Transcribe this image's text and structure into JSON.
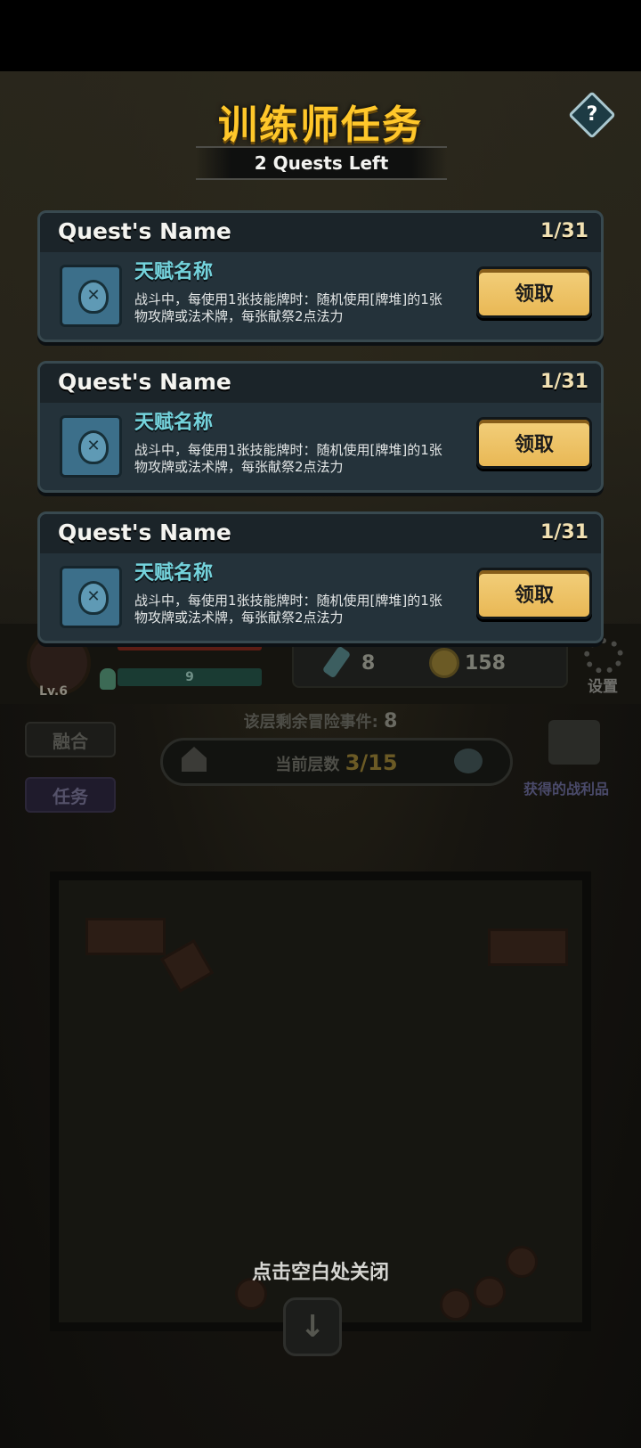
{
  "popup": {
    "title": "训练师任务",
    "quests_left": "2 Quests Left",
    "help_label": "?",
    "close_hint": "点击空白处关闭",
    "quests": [
      {
        "name": "Quest's Name",
        "progress": "1/31",
        "talent_name": "天赋名称",
        "description": "战斗中，每使用1张技能牌时：随机使用[牌堆]的1张物攻牌或法术牌，每张献祭2点法力",
        "claim_label": "领取",
        "icon": "potion-icon"
      },
      {
        "name": "Quest's Name",
        "progress": "1/31",
        "talent_name": "天赋名称",
        "description": "战斗中，每使用1张技能牌时：随机使用[牌堆]的1张物攻牌或法术牌，每张献祭2点法力",
        "claim_label": "领取",
        "icon": "potion-icon"
      },
      {
        "name": "Quest's Name",
        "progress": "1/31",
        "talent_name": "天赋名称",
        "description": "战斗中，每使用1张技能牌时：随机使用[牌堆]的1张物攻牌或法术牌，每张献祭2点法力",
        "claim_label": "领取",
        "icon": "potion-icon"
      }
    ]
  },
  "hud": {
    "level": "Lv.6",
    "mp_value": "9",
    "gems": "8",
    "coins": "158",
    "settings_label": "设置",
    "events_label": "该层剩余冒险事件:",
    "events_value": "8",
    "floor_label": "当前层数",
    "floor_value": "3/15",
    "fuse_label": "融合",
    "task_label": "任务",
    "loot_label": "获得的战利品"
  },
  "colors": {
    "title": "#ffc72a",
    "claim_button": "#f2cf7b",
    "talent_name": "#74d3dc",
    "card_bg": "#24323a"
  }
}
